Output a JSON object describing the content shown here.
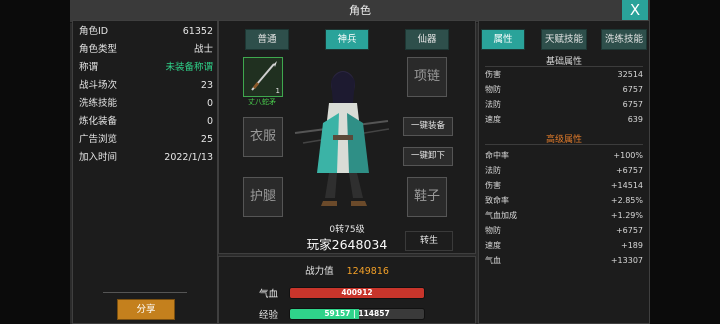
{
  "window": {
    "title": "角色",
    "close_label": "X"
  },
  "profile": [
    {
      "key": "角色ID",
      "value": "61352"
    },
    {
      "key": "角色类型",
      "value": "战士"
    },
    {
      "key": "称谓",
      "value": "未装备称谓"
    },
    {
      "key": "战斗场次",
      "value": "23"
    },
    {
      "key": "洗练技能",
      "value": "0"
    },
    {
      "key": "炼化装备",
      "value": "0"
    },
    {
      "key": "广告浏览",
      "value": "25"
    },
    {
      "key": "加入时间",
      "value": "2022/1/13"
    }
  ],
  "share_label": "分享",
  "equip_tabs": [
    "普通",
    "神兵",
    "仙器"
  ],
  "equip_active_tab": "神兵",
  "slots": {
    "weapon": {
      "name": "丈八蛇矛",
      "count": "1",
      "icon": "spear-icon"
    },
    "clothes": "衣服",
    "legs": "护腿",
    "necklace": "项链",
    "shoes": "鞋子"
  },
  "actions": {
    "equip_all": "一键装备",
    "unequip_all": "一键卸下"
  },
  "character": {
    "level_text": "0转75级",
    "name": "玩家2648034",
    "rebirth_label": "转生"
  },
  "power": {
    "label": "战力值",
    "value": "1249816"
  },
  "bars": {
    "hp": {
      "label": "气血",
      "value": "400912",
      "fill_pct": 100,
      "color": "#c8352b"
    },
    "exp": {
      "label": "经验",
      "current": "59157",
      "max": "114857",
      "fill_pct": 51.5,
      "color": "#2fd38a"
    }
  },
  "attr_tabs": [
    "属性",
    "天赋技能",
    "洗练技能"
  ],
  "attr_active_tab": "属性",
  "base_title": "基础属性",
  "base_attrs": [
    {
      "key": "伤害",
      "value": "32514"
    },
    {
      "key": "物防",
      "value": "6757"
    },
    {
      "key": "法防",
      "value": "6757"
    },
    {
      "key": "速度",
      "value": "639"
    }
  ],
  "adv_title": "高级属性",
  "adv_attrs": [
    {
      "key": "命中率",
      "value": "+100%"
    },
    {
      "key": "法防",
      "value": "+6757"
    },
    {
      "key": "伤害",
      "value": "+14514"
    },
    {
      "key": "致命率",
      "value": "+2.85%"
    },
    {
      "key": "气血加成",
      "value": "+1.29%"
    },
    {
      "key": "物防",
      "value": "+6757"
    },
    {
      "key": "速度",
      "value": "+189"
    },
    {
      "key": "气血",
      "value": "+13307"
    }
  ],
  "colors": {
    "accent": "#2aa39a",
    "title_highlight": "#e07a2a",
    "power": "#f2a028"
  }
}
